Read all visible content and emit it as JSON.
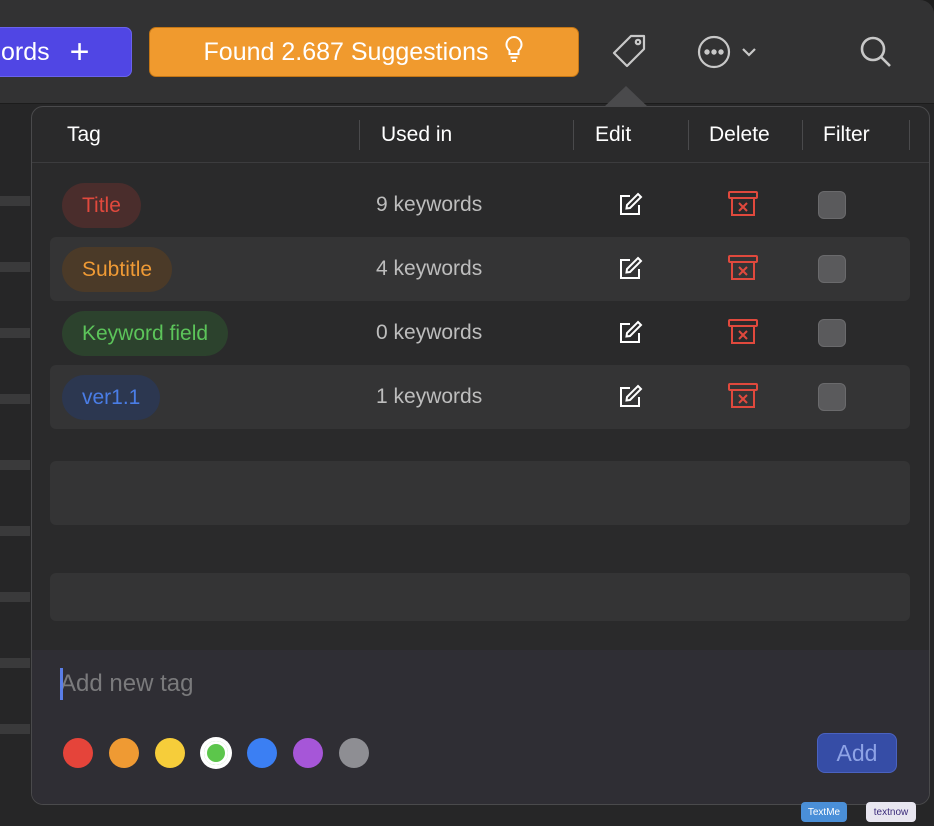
{
  "toolbar": {
    "keywords_button": "ords",
    "suggestions_button": "Found 2.687 Suggestions"
  },
  "table": {
    "headers": {
      "tag": "Tag",
      "used_in": "Used in",
      "edit": "Edit",
      "delete": "Delete",
      "filter": "Filter"
    },
    "rows": [
      {
        "tag": "Title",
        "used_in": "9 keywords",
        "color": "#e0493d",
        "bg": "#4a2d2c"
      },
      {
        "tag": "Subtitle",
        "used_in": "4 keywords",
        "color": "#ef9a35",
        "bg": "#4b3a28"
      },
      {
        "tag": "Keyword field",
        "used_in": "0 keywords",
        "color": "#5cc45a",
        "bg": "#2c422d"
      },
      {
        "tag": "ver1.1",
        "used_in": "1 keywords",
        "color": "#4a7de6",
        "bg": "#2c3750"
      }
    ]
  },
  "new_tag": {
    "placeholder": "Add new tag",
    "add_button": "Add",
    "colors": [
      "#e5443a",
      "#ef9a33",
      "#f6cd3a",
      "#5cc64b",
      "#3b7ff3",
      "#a656d8",
      "#8e8e93"
    ],
    "selected_color_index": 3
  },
  "dock": {
    "app1": "TextMe",
    "app2": "textnow"
  }
}
